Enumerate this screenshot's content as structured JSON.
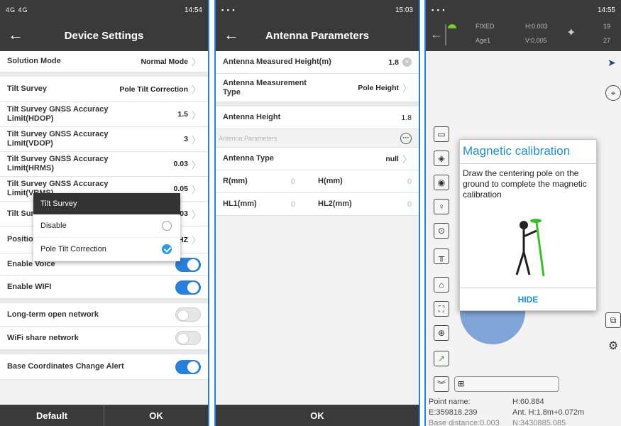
{
  "panel1": {
    "status_left": "4G 4G",
    "status_right": "14:54",
    "title": "Device Settings",
    "rows": [
      {
        "label": "Solution Mode",
        "value": "Normal Mode"
      },
      {
        "label": "Tilt Survey",
        "value": "Pole Tilt Correction"
      },
      {
        "label": "Tilt Survey GNSS Accuracy Limit(HDOP)",
        "value": "1.5"
      },
      {
        "label": "Tilt Survey GNSS Accuracy Limit(VDOP)",
        "value": "3"
      },
      {
        "label": "Tilt Survey GNSS Accuracy Limit(HRMS)",
        "value": "0.03"
      },
      {
        "label": "Tilt Survey GNSS Accuracy Limit(VRMS)",
        "value": "0.05"
      },
      {
        "label": "Tilt Survey Limit",
        "value": "0.03"
      },
      {
        "label": "Position frequency",
        "value": "1HZ"
      },
      {
        "label": "Enable Voice"
      },
      {
        "label": "Enable WIFI"
      },
      {
        "label": "Long-term open network"
      },
      {
        "label": "WiFi share network"
      },
      {
        "label": "Base Coordinates Change Alert"
      }
    ],
    "dialog": {
      "title": "Tilt Survey",
      "options": [
        {
          "label": "Disable"
        },
        {
          "label": "Pole Tilt Correction"
        }
      ]
    },
    "footer": {
      "default_label": "Default",
      "ok_label": "OK"
    }
  },
  "panel2": {
    "status_right": "15:03",
    "title": "Antenna Parameters",
    "measured_height": {
      "label": "Antenna Measured Height(m)",
      "value": "1.8"
    },
    "measurement_type": {
      "label": "Antenna Measurement Type",
      "value": "Pole Height"
    },
    "antenna_height": {
      "label": "Antenna Height",
      "value": "1.8"
    },
    "section_label": "Antenna Parameters",
    "antenna_type": {
      "label": "Antenna Type",
      "value": "null"
    },
    "r_label": "R(mm)",
    "r_value": "0",
    "h_label": "H(mm)",
    "h_value": "0",
    "hl1_label": "HL1(mm)",
    "hl1_value": "0",
    "hl2_label": "HL2(mm)",
    "hl2_value": "0",
    "ok_label": "OK"
  },
  "panel3": {
    "status_right": "14:55",
    "fix": "FIXED",
    "age": "Age1",
    "h_prec": "H:0.003",
    "v_prec": "V:0.005",
    "sat_top": "19",
    "sat_bottom": "27",
    "dialog": {
      "title": "Magnetic calibration",
      "text": "Draw the centering pole on the ground to complete the magnetic calibration",
      "hide_label": "HIDE"
    },
    "point_name": "Point name:",
    "e_coord": "E:359818.239",
    "base_distance": "Base distance:0.003",
    "h_value": "H:60.884",
    "ant_h": "Ant. H:1.8m+0.072m",
    "n_coord": "N:3430885.085"
  }
}
